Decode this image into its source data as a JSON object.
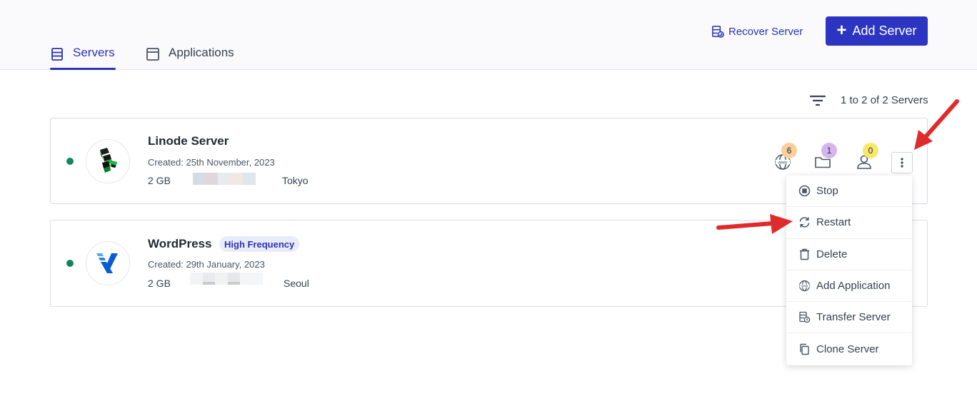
{
  "tabs": [
    {
      "label": "Servers",
      "active": true
    },
    {
      "label": "Applications",
      "active": false
    }
  ],
  "header": {
    "recover_label": "Recover Server",
    "add_label": "Add Server"
  },
  "toolbar": {
    "count_text": "1 to 2 of 2 Servers"
  },
  "servers": [
    {
      "name": "Linode Server",
      "created": "Created: 25th November, 2023",
      "ram": "2 GB",
      "region": "Tokyo",
      "status_color": "#12855f",
      "stats": [
        {
          "icon": "www-globe-icon",
          "count": "6",
          "color": "#f9cf9c"
        },
        {
          "icon": "folder-icon",
          "count": "1",
          "color": "#d6b5ee"
        },
        {
          "icon": "user-icon",
          "count": "0",
          "color": "#f7e86c"
        }
      ]
    },
    {
      "name": "WordPress",
      "badge": "High Frequency",
      "created": "Created: 29th January, 2023",
      "ram": "2 GB",
      "region": "Seoul",
      "status_color": "#12855f"
    }
  ],
  "menu": [
    {
      "label": "Stop",
      "icon": "stop-icon"
    },
    {
      "label": "Restart",
      "icon": "restart-icon"
    },
    {
      "label": "Delete",
      "icon": "trash-icon"
    },
    {
      "label": "Add Application",
      "icon": "www-globe-icon"
    },
    {
      "label": "Transfer Server",
      "icon": "transfer-icon"
    },
    {
      "label": "Clone Server",
      "icon": "copy-icon"
    }
  ],
  "colors": {
    "accent": "#2c35c2",
    "annotation_arrow": "#e02b2b"
  }
}
